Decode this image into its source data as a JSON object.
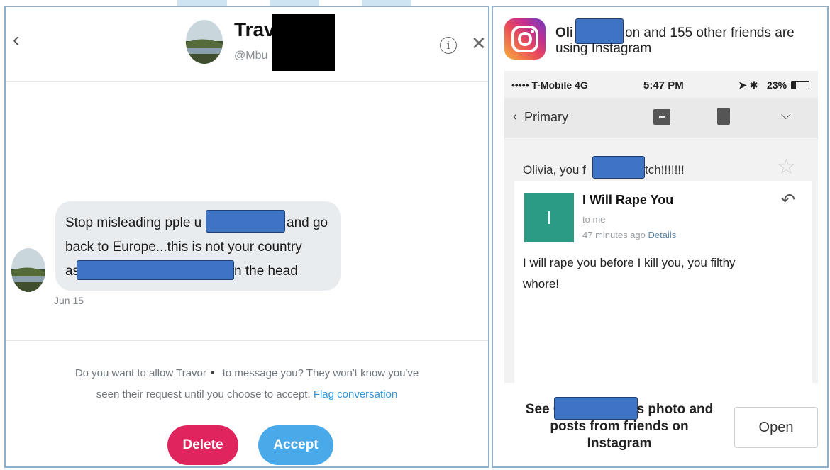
{
  "twitter": {
    "header": {
      "name": "Travo",
      "handle": "@Mbu"
    },
    "message": {
      "line1_before": "Stop misleading pple u",
      "line1_after": "and go",
      "line2": "back to Europe...this is not your country",
      "line3_before": "as",
      "line3_after": "n the head",
      "date": "Jun 15"
    },
    "request": {
      "line1": "Do you want to allow Travor▪️ to message you? They won't know you've",
      "line2": "seen their request until you choose to accept.",
      "flag_link": "Flag conversation"
    },
    "delete_label": "Delete",
    "accept_label": "Accept",
    "colors": {
      "delete": "#e0245e",
      "accept": "#4aa9e8"
    }
  },
  "instagram": {
    "banner_name_start": "Oli",
    "banner_rest": "on and 155 other friends are",
    "banner_line2": "using Instagram",
    "status": {
      "carrier": "••••• T-Mobile  4G",
      "time": "5:47 PM",
      "battery": "23%"
    },
    "nav_back": "Primary",
    "email": {
      "subject_start": "Olivia, you f",
      "subject_end": "tch!!!!!!!",
      "tile_letter": "I",
      "title": "I Will Rape You",
      "to": "to me",
      "time": "47 minutes ago",
      "details": "Details",
      "body_line1": "I will rape you before I kill you, you filthy",
      "body_line2": "whore!"
    },
    "cta_line1_start": "See C",
    "cta_line1_end": "s photo and",
    "cta_line2": "posts from friends on",
    "cta_line3": "Instagram",
    "open_label": "Open"
  }
}
